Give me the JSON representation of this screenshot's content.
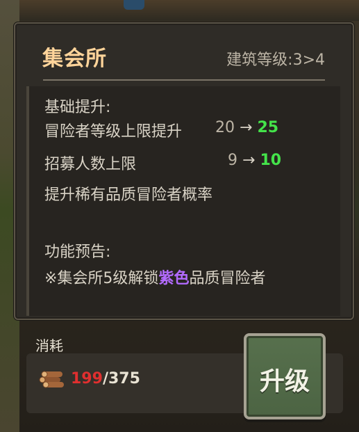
{
  "panel": {
    "title": "集会所",
    "level_text": "建筑等级:3>4"
  },
  "details": {
    "section_basic": "基础提升:",
    "rows": [
      {
        "label": "冒险者等级上限提升",
        "old": "20",
        "arrow": "→",
        "new": "25"
      },
      {
        "label": "招募人数上限",
        "old": "9",
        "arrow": "→",
        "new": "10"
      }
    ],
    "rare_line": "提升稀有品质冒险者概率",
    "section_preview": "功能预告:",
    "preview": {
      "prefix": "※集会所5级解锁",
      "highlight": "紫色",
      "suffix": "品质冒险者"
    }
  },
  "cost": {
    "label": "消耗",
    "icon": "wood-logs-icon",
    "have": "199",
    "separator": "/",
    "need": "375"
  },
  "upgrade_button": {
    "label": "升级"
  },
  "colors": {
    "title": "#ffd49a",
    "increase": "#44e34a",
    "insufficient": "#e02f2f",
    "purple_quality": "#b36bff",
    "button_green": "#57704d"
  }
}
